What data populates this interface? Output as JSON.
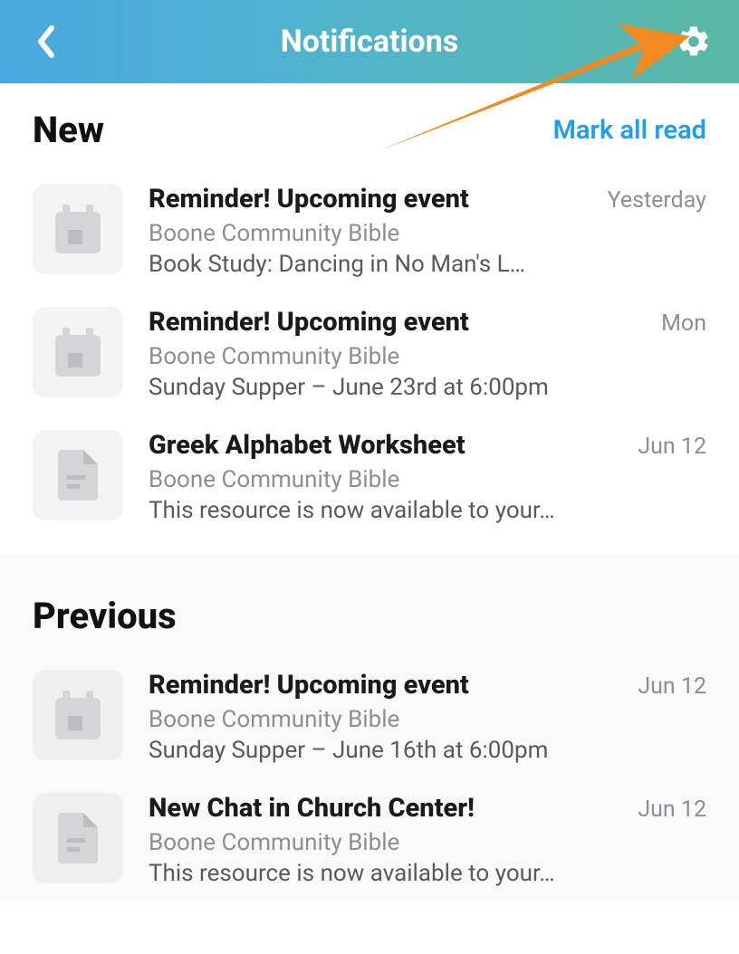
{
  "header": {
    "title": "Notifications"
  },
  "sections": {
    "new": {
      "label": "New",
      "mark_all": "Mark all read",
      "items": [
        {
          "icon": "calendar",
          "title": "Reminder! Upcoming event",
          "time": "Yesterday",
          "source": "Boone Community Bible",
          "desc": "Book Study: Dancing in No Man's L…"
        },
        {
          "icon": "calendar",
          "title": "Reminder! Upcoming event",
          "time": "Mon",
          "source": "Boone Community Bible",
          "desc": "Sunday Supper – June 23rd at 6:00pm"
        },
        {
          "icon": "document",
          "title": "Greek Alphabet Worksheet",
          "time": "Jun 12",
          "source": "Boone Community Bible",
          "desc": "This resource is now available to your…"
        }
      ]
    },
    "previous": {
      "label": "Previous",
      "items": [
        {
          "icon": "calendar",
          "title": "Reminder! Upcoming event",
          "time": "Jun 12",
          "source": "Boone Community Bible",
          "desc": "Sunday Supper – June 16th at 6:00pm"
        },
        {
          "icon": "document",
          "title": "New Chat in Church Center!",
          "time": "Jun 12",
          "source": "Boone Community Bible",
          "desc": "This resource is now available to your…"
        }
      ]
    }
  }
}
